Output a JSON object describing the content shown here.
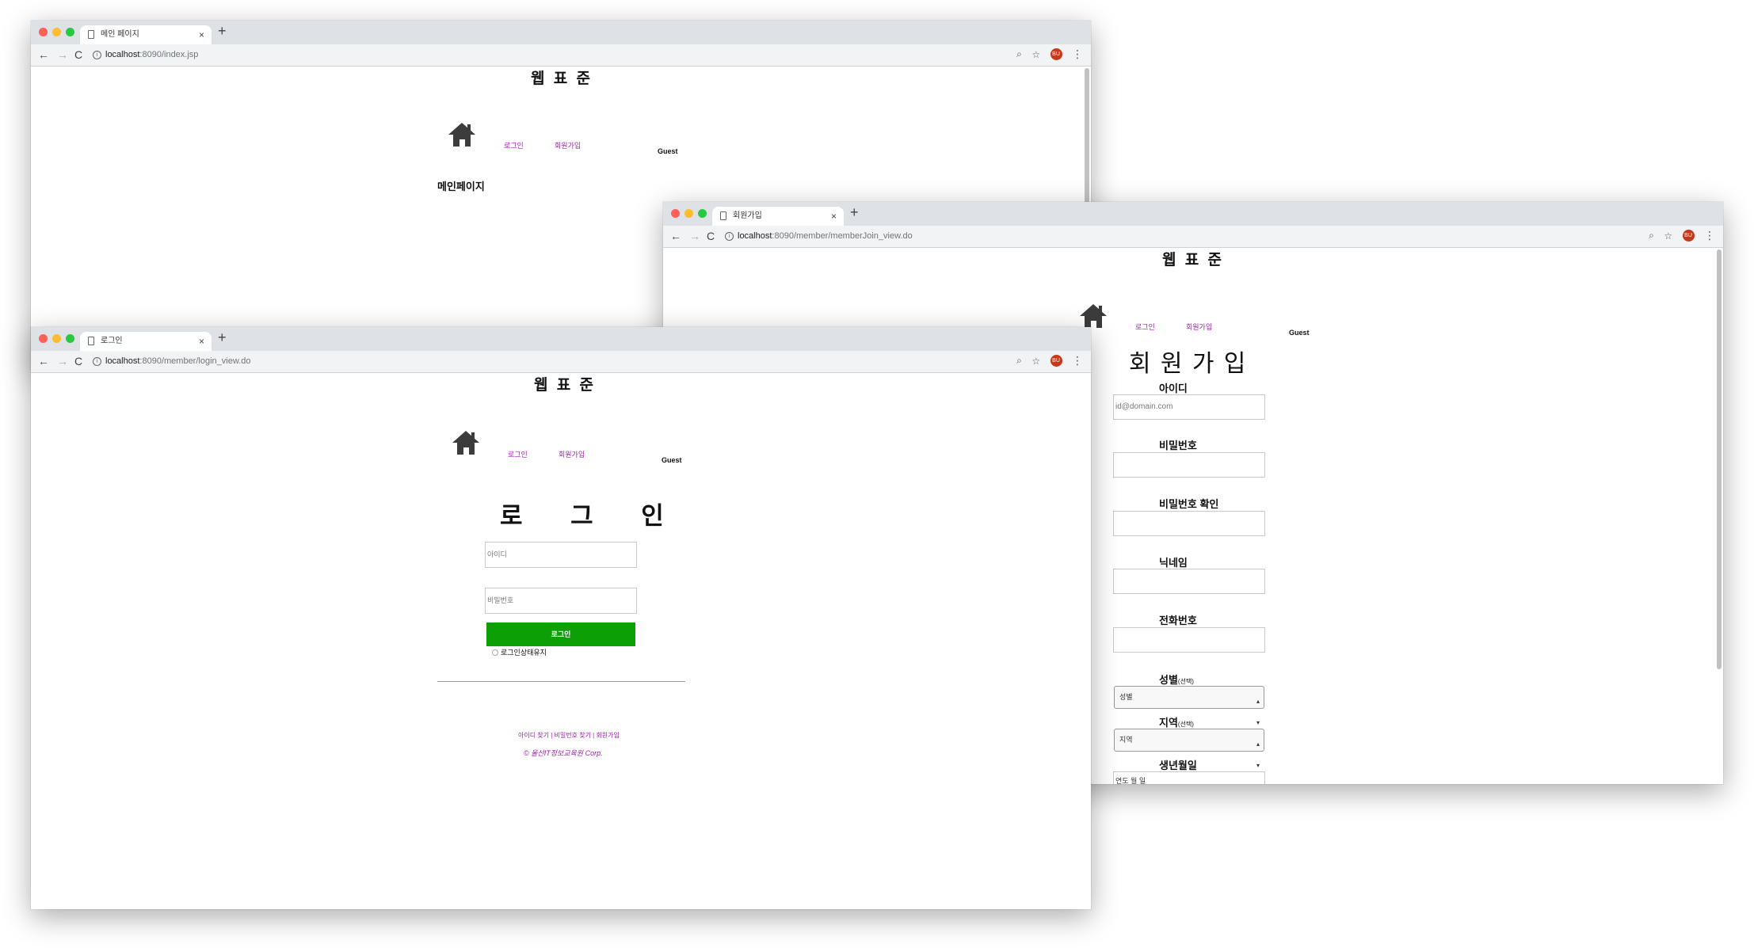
{
  "common": {
    "new_tab": "+",
    "tab_close": "×",
    "nav_back": "←",
    "nav_forward": "→",
    "nav_reload": "C",
    "host": "localhost",
    "zoom_icon": "⌕",
    "star_icon": "☆",
    "avatar_text": "BU",
    "menu_icon": "⋮",
    "info_icon": "i",
    "site_title": "웹 표 준",
    "nav_login": "로그인",
    "nav_join": "회원가입",
    "guest": "Guest"
  },
  "window_main": {
    "tab_title": "메인 페이지",
    "url_path": ":8090/index.jsp",
    "page_heading": "메인페이지"
  },
  "window_join": {
    "tab_title": "회원가입",
    "url_path": ":8090/member/memberJoin_view.do",
    "heading": "회 원 가 입",
    "id_label": "아이디",
    "id_placeholder": "id@domain.com",
    "pw_label": "비밀번호",
    "pw_confirm_label": "비밀번호 확인",
    "nickname_label": "닉네임",
    "phone_label": "전화번호",
    "gender_label": "성별",
    "gender_optional": "(선택)",
    "gender_select": "성별",
    "region_label": "지역",
    "region_optional": "(선택)",
    "region_select": "지역",
    "birth_label": "생년월일",
    "birth_partial": "연도 월 일"
  },
  "window_login": {
    "tab_title": "로그인",
    "url_path": ":8090/member/login_view.do",
    "heading": "로 그 인",
    "id_placeholder": "아이디",
    "pw_placeholder": "비밀번호",
    "login_button": "로그인",
    "keep_login": "로그인상태유지",
    "footer_links": "아이디 찾기 | 비밀번호 찾기 | 회원가입",
    "copyright": "© 울산IT정보교육원 Corp."
  },
  "colors": {
    "link_purple": "#a020b0",
    "login_button_green": "#0c9f06",
    "tab_bar_gray": "#dee1e6",
    "toolbar_gray": "#f1f3f4"
  }
}
